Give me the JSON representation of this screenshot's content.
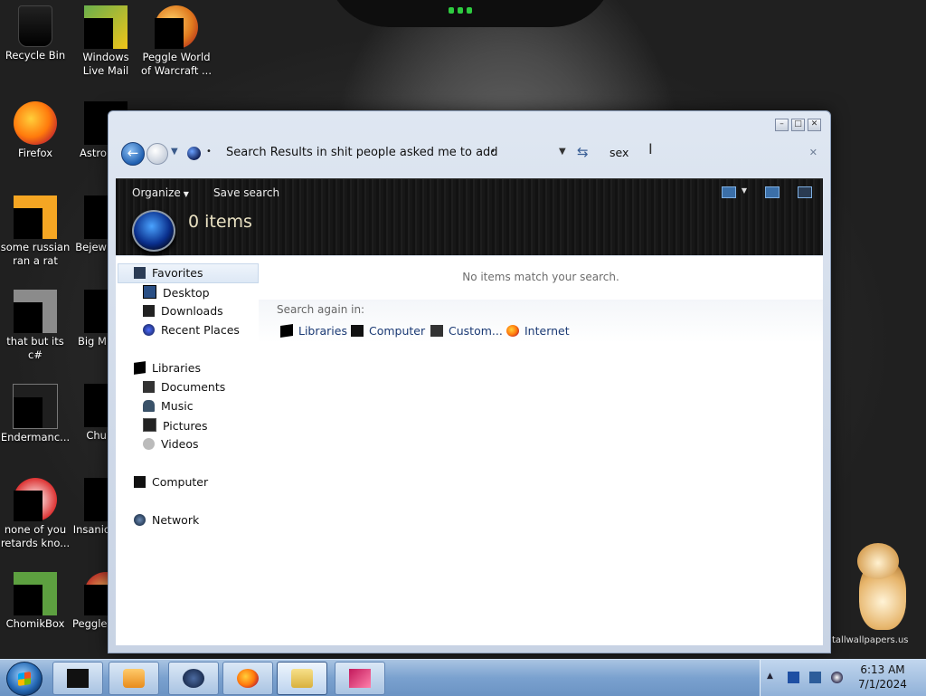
{
  "desktop": {
    "icons": [
      {
        "label": "Recycle Bin"
      },
      {
        "label": "Windows Live Mail"
      },
      {
        "label": "Peggle World of Warcraft ..."
      },
      {
        "label": "Firefox"
      },
      {
        "label": "Astro Delu"
      },
      {
        "label": "some russian ran a rat"
      },
      {
        "label": "Bejew Delu"
      },
      {
        "label": "that but its c#"
      },
      {
        "label": "Big M Delu"
      },
      {
        "label": "Endermanc..."
      },
      {
        "label": "Chu Delu"
      },
      {
        "label": "none of you retards kno..."
      },
      {
        "label": "Insanio Delu"
      },
      {
        "label": "ChomikBox"
      },
      {
        "label": "Peggle"
      }
    ],
    "watermark": "tallwallpapers.us"
  },
  "window": {
    "address_text": "Search Results in shit people asked me to add",
    "search_value": "sex",
    "toolbar": {
      "organize_label": "Organize",
      "save_search_label": "Save search"
    },
    "items_count": "0 items",
    "nav": {
      "favorites": "Favorites",
      "desktop": "Desktop",
      "downloads": "Downloads",
      "recent": "Recent Places",
      "libraries": "Libraries",
      "documents": "Documents",
      "music": "Music",
      "pictures": "Pictures",
      "videos": "Videos",
      "computer": "Computer",
      "network": "Network"
    },
    "content": {
      "empty_message": "No items match your search.",
      "search_again_label": "Search again in:",
      "search_again": [
        "Libraries",
        "Computer",
        "Custom...",
        "Internet"
      ]
    }
  },
  "taskbar": {
    "time": "6:13 AM",
    "date": "7/1/2024"
  }
}
